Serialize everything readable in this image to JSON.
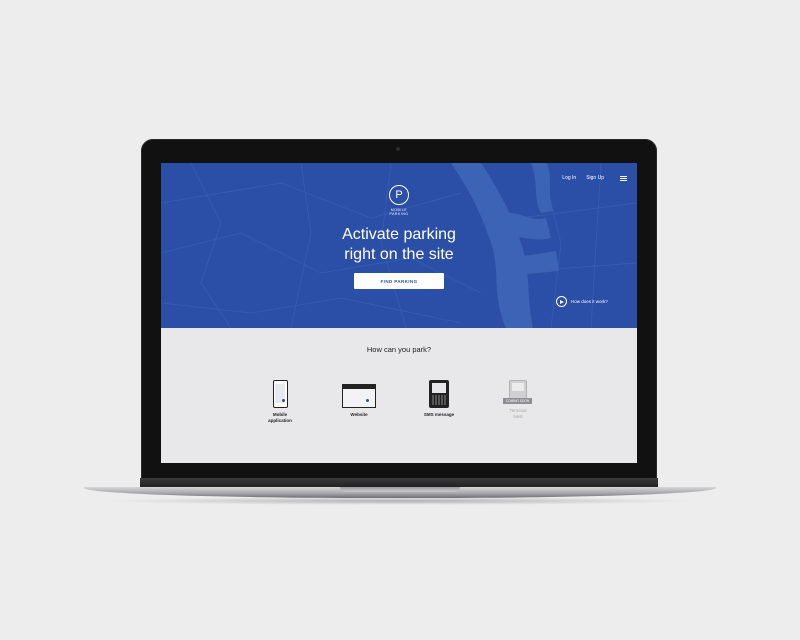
{
  "header": {
    "login_label": "Log In",
    "signup_label": "Sign Up",
    "menu_icon": "hamburger-icon"
  },
  "logo": {
    "letter": "P",
    "text_line1": "MOBILE",
    "text_line2": "PARKING"
  },
  "hero": {
    "headline_line1": "Activate parking",
    "headline_line2": "right on the site",
    "cta_label": "FIND PARKING",
    "how_label": "How does it work?"
  },
  "section": {
    "title": "How can you park?",
    "methods": [
      {
        "label_line1": "Mobile",
        "label_line2": "application",
        "icon": "smartphone-icon"
      },
      {
        "label_line1": "Website",
        "label_line2": "",
        "icon": "browser-icon"
      },
      {
        "label_line1": "SMS message",
        "label_line2": "",
        "icon": "feature-phone-icon"
      },
      {
        "label_line1": "Terminal",
        "label_line2": "Nest",
        "icon": "terminal-icon",
        "badge": "COMING SOON"
      }
    ]
  },
  "colors": {
    "brand_blue": "#2b4fa6",
    "page_bg": "#ededed",
    "section_bg": "#e8e8eb"
  }
}
